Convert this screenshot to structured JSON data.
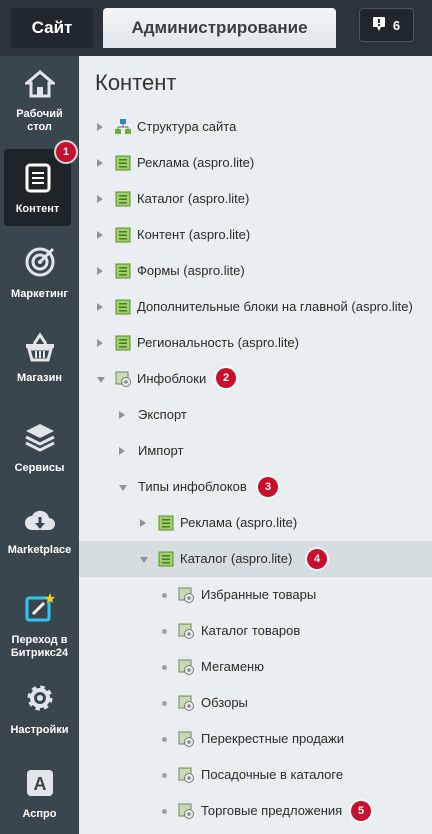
{
  "top_tabs": {
    "site": "Сайт",
    "admin": "Администрирование"
  },
  "notifications": {
    "count": "6"
  },
  "left_menu": [
    {
      "label_1": "Рабочий",
      "label_2": "стол"
    },
    {
      "label_1": "Контент",
      "label_2": ""
    },
    {
      "label_1": "Маркетинг",
      "label_2": ""
    },
    {
      "label_1": "Магазин",
      "label_2": ""
    },
    {
      "label_1": "Сервисы",
      "label_2": ""
    },
    {
      "label_1": "Marketplace",
      "label_2": ""
    },
    {
      "label_1": "Переход в",
      "label_2": "Битрикс24"
    },
    {
      "label_1": "Настройки",
      "label_2": ""
    },
    {
      "label_1": "Аспро",
      "label_2": ""
    }
  ],
  "panel": {
    "title": "Контент"
  },
  "tree": [
    {
      "label": "Структура сайта"
    },
    {
      "label": "Реклама (aspro.lite)"
    },
    {
      "label": "Каталог (aspro.lite)"
    },
    {
      "label": "Контент (aspro.lite)"
    },
    {
      "label": "Формы (aspro.lite)"
    },
    {
      "label": "Дополнительные блоки на главной (aspro.lite)"
    },
    {
      "label": "Региональность (aspro.lite)"
    },
    {
      "label": "Инфоблоки"
    },
    {
      "label": "Экспорт"
    },
    {
      "label": "Импорт"
    },
    {
      "label": "Типы инфоблоков"
    },
    {
      "label": "Реклама (aspro.lite)"
    },
    {
      "label": "Каталог (aspro.lite)"
    },
    {
      "label": "Избранные товары"
    },
    {
      "label": "Каталог товаров"
    },
    {
      "label": "Мегаменю"
    },
    {
      "label": "Обзоры"
    },
    {
      "label": "Перекрестные продажи"
    },
    {
      "label": "Посадочные в каталоге"
    },
    {
      "label": "Торговые предложения"
    }
  ],
  "badges": [
    "1",
    "2",
    "3",
    "4",
    "5"
  ],
  "colors": {
    "badge": "#c8102e",
    "panel_bg": "#e9eef0",
    "menu_bg": "#3a464d"
  }
}
